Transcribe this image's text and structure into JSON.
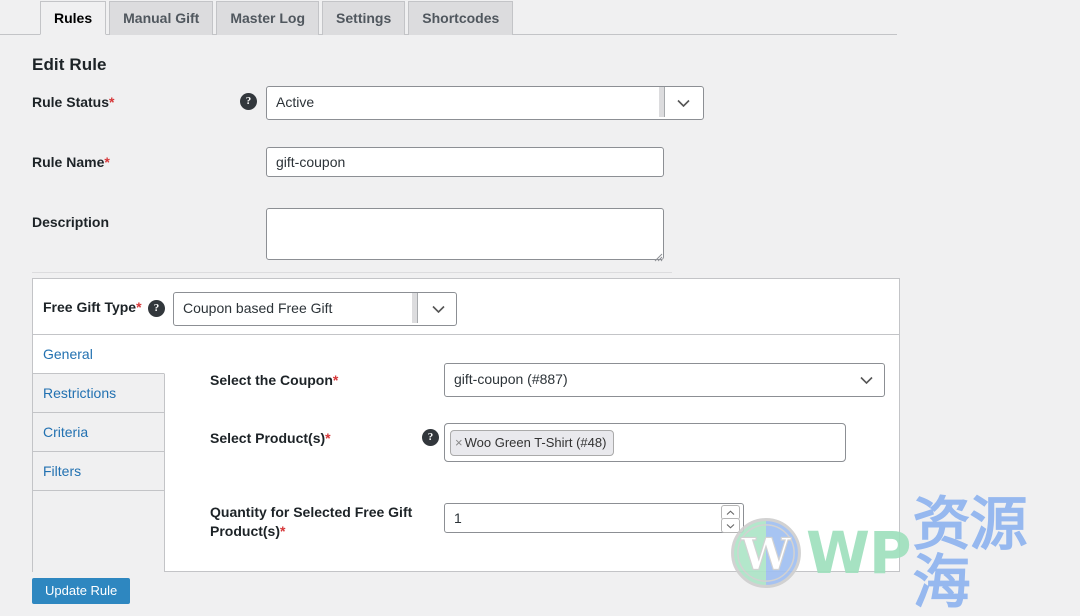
{
  "nav_tabs": [
    {
      "label": "Rules",
      "active": true
    },
    {
      "label": "Manual Gift",
      "active": false
    },
    {
      "label": "Master Log",
      "active": false
    },
    {
      "label": "Settings",
      "active": false
    },
    {
      "label": "Shortcodes",
      "active": false
    }
  ],
  "page": {
    "heading": "Edit Rule"
  },
  "form": {
    "rule_status": {
      "label": "Rule Status",
      "required": "*",
      "help": "?",
      "value": "Active"
    },
    "rule_name": {
      "label": "Rule Name",
      "required": "*",
      "value": "gift-coupon",
      "placeholder": ""
    },
    "description": {
      "label": "Description",
      "value": "",
      "placeholder": ""
    }
  },
  "gift_panel": {
    "gift_type": {
      "label": "Free Gift Type",
      "required": "*",
      "help": "?",
      "value": "Coupon based Free Gift"
    },
    "vertical_tabs": [
      {
        "label": "General",
        "active": true
      },
      {
        "label": "Restrictions",
        "active": false
      },
      {
        "label": "Criteria",
        "active": false
      },
      {
        "label": "Filters",
        "active": false
      }
    ],
    "fields": {
      "coupon": {
        "label": "Select the Coupon",
        "required": "*",
        "value": "gift-coupon (#887)"
      },
      "products": {
        "label": "Select Product(s)",
        "required": "*",
        "help": "?",
        "tokens": [
          {
            "remove": "×",
            "label": "Woo Green T-Shirt (#48)"
          }
        ]
      },
      "quantity": {
        "label_line1": "Quantity for Selected Free Gift",
        "label_line2": "Product(s)",
        "required": "*",
        "value": "1"
      }
    }
  },
  "actions": {
    "submit": "Update Rule"
  },
  "watermark": {
    "latin": "WP",
    "cjk": "资源海"
  },
  "colors": {
    "page_bg": "#f0f0f1",
    "accent_link": "#2271b1",
    "required": "#d63638",
    "button": "#2e87c0",
    "border": "#8c8f94",
    "watermark_latin": "#9fe0bd",
    "watermark_cjk": "#8fb4ef"
  }
}
